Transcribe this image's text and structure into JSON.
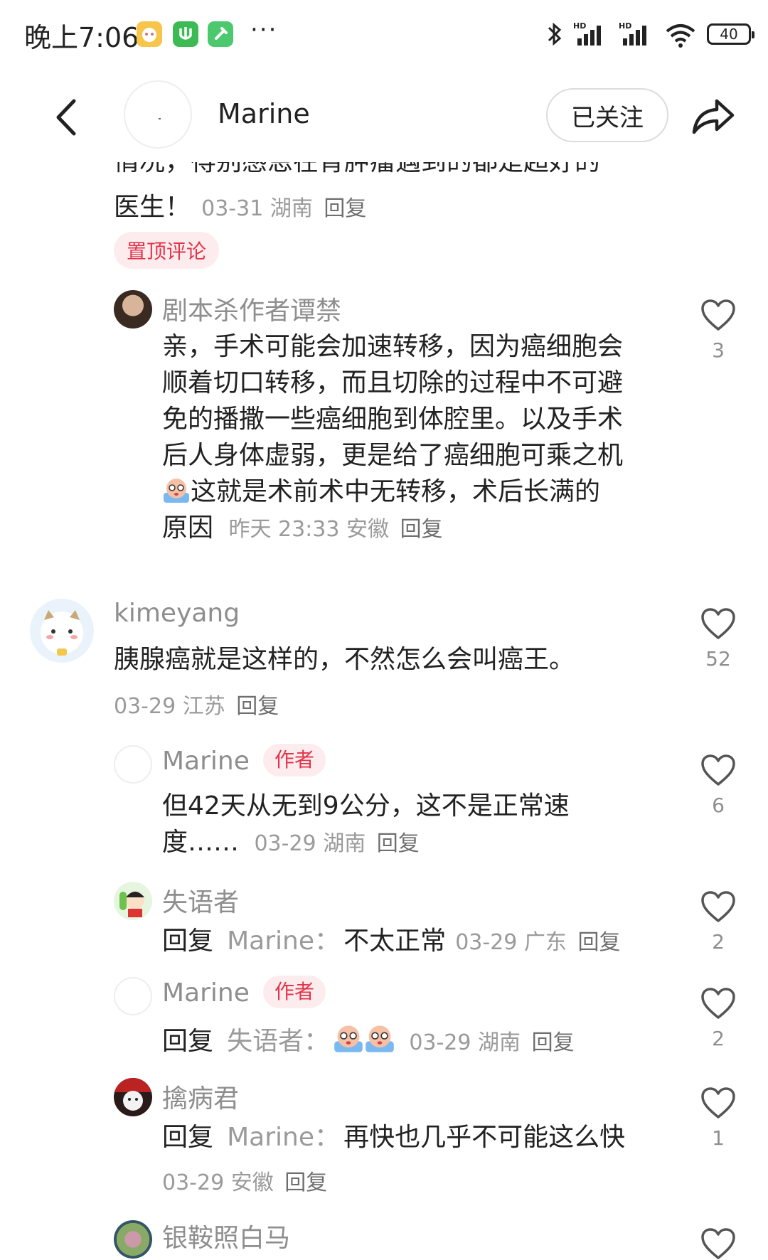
{
  "status_bar": {
    "time": "晚上7:06",
    "battery": "40",
    "more": "···"
  },
  "header": {
    "title": "Marine",
    "follow_label": "已关注"
  },
  "pinned_partial": {
    "cut_line": "情况，得别感恩在肯肿瘤遇到的都是超好的",
    "last_line": "医生！",
    "date": "03-31",
    "region": "湖南",
    "reply": "回复",
    "pinned_badge": "置顶评论"
  },
  "comments": [
    {
      "user": "剧本杀作者谭禁",
      "lines": [
        "亲，手术可能会加速转移，因为癌细胞会",
        "顺着切口转移，而且切除的过程中不可避",
        "免的播撒一些癌细胞到体腔里。以及手术",
        "后人身体虚弱，更是给了癌细胞可乘之机"
      ],
      "line5": "这就是术前术中无转移，术后长满的",
      "line6": "原因",
      "date": "昨天 23:33",
      "region": "安徽",
      "reply": "回复",
      "likes": "3"
    },
    {
      "user": "kimeyang",
      "text": "胰腺癌就是这样的，不然怎么会叫癌王。",
      "date": "03-29",
      "region": "江苏",
      "reply": "回复",
      "likes": "52"
    },
    {
      "user": "Marine",
      "badge": "作者",
      "line1": "但42天从无到9公分，这不是正常速",
      "line2": "度……",
      "date": "03-29",
      "region": "湖南",
      "reply": "回复",
      "likes": "6"
    },
    {
      "user": "失语者",
      "reply_prefix": "回复",
      "reply_to": "Marine：",
      "text": "不太正常",
      "date": "03-29",
      "region": "广东",
      "reply": "回复",
      "likes": "2"
    },
    {
      "user": "Marine",
      "badge": "作者",
      "reply_prefix": "回复",
      "reply_to": "失语者：",
      "date": "03-29",
      "region": "湖南",
      "reply": "回复",
      "likes": "2"
    },
    {
      "user": "擒病君",
      "reply_prefix": "回复",
      "reply_to": "Marine：",
      "text": "再快也几乎不可能这么快",
      "date": "03-29",
      "region": "安徽",
      "reply": "回复",
      "likes": "1"
    },
    {
      "user": "银鞍照白马"
    }
  ],
  "colors": {
    "badge_red": "#e2344a",
    "badge_bg": "#fdecee",
    "meta_gray": "#9a9a9a"
  }
}
